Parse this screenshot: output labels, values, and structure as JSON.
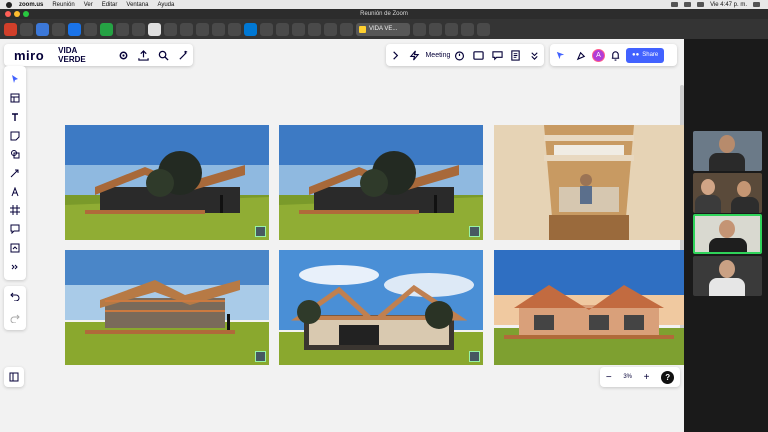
{
  "mac_menubar": {
    "app": "zoom.us",
    "menus": [
      "Reunión",
      "Ver",
      "Editar",
      "Ventana",
      "Ayuda"
    ],
    "clock": "Vie 4:47 p. m."
  },
  "zoom": {
    "window_title": "Reunión de Zoom"
  },
  "browser": {
    "active_tab_label": "VIDA VE..."
  },
  "miro": {
    "logo": "miro",
    "board_name": "VIDA VERDE",
    "meeting_label": "Meeting",
    "share_label": "Share",
    "avatar_initial": "A",
    "zoom_level": "3%",
    "help_label": "?"
  },
  "colors": {
    "accent": "#4262ff",
    "speaker_border": "#2fd35a",
    "avatar": "#b13dd8"
  },
  "images": [
    {
      "name": "render-1",
      "scene": "container-house-side-trees"
    },
    {
      "name": "render-2",
      "scene": "container-house-side-trees"
    },
    {
      "name": "render-3",
      "scene": "interior-man-sitting"
    },
    {
      "name": "render-4",
      "scene": "container-house-steel-frame"
    },
    {
      "name": "render-5",
      "scene": "container-house-front-trees"
    },
    {
      "name": "render-6",
      "scene": "container-house-front-sunset"
    }
  ]
}
